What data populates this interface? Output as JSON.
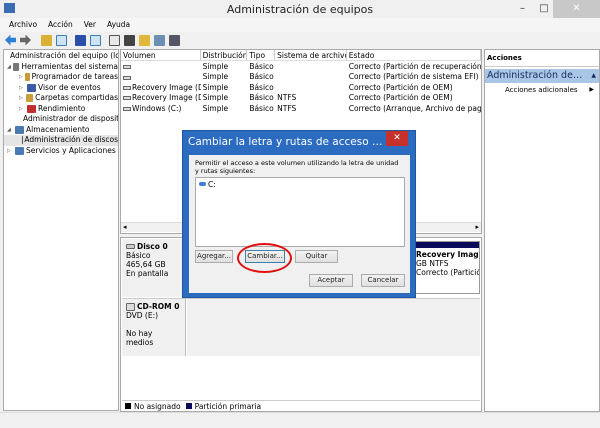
{
  "window": {
    "title": "Administración de equipos",
    "minimize": "–",
    "maximize": "□",
    "close": "✕"
  },
  "menu": [
    "Archivo",
    "Acción",
    "Ver",
    "Ayuda"
  ],
  "tree": [
    {
      "label": "Administración del equipo (local)",
      "level": 0,
      "expander": ""
    },
    {
      "label": "Herramientas del sistema",
      "level": 1,
      "expander": "◢"
    },
    {
      "label": "Programador de tareas",
      "level": 2,
      "expander": "▷"
    },
    {
      "label": "Visor de eventos",
      "level": 2,
      "expander": "▷"
    },
    {
      "label": "Carpetas compartidas",
      "level": 2,
      "expander": "▷"
    },
    {
      "label": "Rendimiento",
      "level": 2,
      "expander": "▷"
    },
    {
      "label": "Administrador de dispositivos",
      "level": 2,
      "expander": ""
    },
    {
      "label": "Almacenamiento",
      "level": 1,
      "expander": "◢"
    },
    {
      "label": "Administración de discos",
      "level": 2,
      "expander": ""
    },
    {
      "label": "Servicios y Aplicaciones",
      "level": 1,
      "expander": "▷"
    }
  ],
  "volumes": {
    "headers": [
      "Volumen",
      "Distribución",
      "Tipo",
      "Sistema de archivos",
      "Estado"
    ],
    "rows": [
      [
        "",
        "Simple",
        "Básico",
        "",
        "Correcto (Partición de recuperación)"
      ],
      [
        "",
        "Simple",
        "Básico",
        "",
        "Correcto (Partición de sistema EFI)"
      ],
      [
        "Recovery Image (D:)",
        "Simple",
        "Básico",
        "",
        "Correcto (Partición de OEM)"
      ],
      [
        "Recovery Image (D:)",
        "Simple",
        "Básico",
        "NTFS",
        "Correcto (Partición de OEM)"
      ],
      [
        "Windows (C:)",
        "Simple",
        "Básico",
        "NTFS",
        "Correcto (Arranque, Archivo de paginación)"
      ]
    ]
  },
  "disks": [
    {
      "name": "Disco 0",
      "type": "Básico",
      "size": "465,64 GB",
      "status": "En pantalla"
    },
    {
      "name": "CD-ROM 0",
      "type": "DVD (E:)",
      "size": "",
      "status": "No hay medios"
    }
  ],
  "partition": {
    "name": "Recovery Image  (D:)",
    "size": "GB NTFS",
    "status": "Correcto (Partición de"
  },
  "legend": [
    {
      "label": "No asignado",
      "color": "#000000"
    },
    {
      "label": "Partición primaria",
      "color": "#0a0a5a"
    }
  ],
  "actions": {
    "header": "Acciones",
    "section": "Administración de discos",
    "item": "Acciones adicionales"
  },
  "dialog": {
    "title": "Cambiar la letra y rutas de acceso de unidad para...",
    "description": "Permitir el acceso a este volumen utilizando la letra de unidad y rutas siguientes:",
    "entry": "C:",
    "add": "Agregar...",
    "change": "Cambiar...",
    "remove": "Quitar",
    "ok": "Aceptar",
    "cancel": "Cancelar",
    "close": "✕"
  }
}
